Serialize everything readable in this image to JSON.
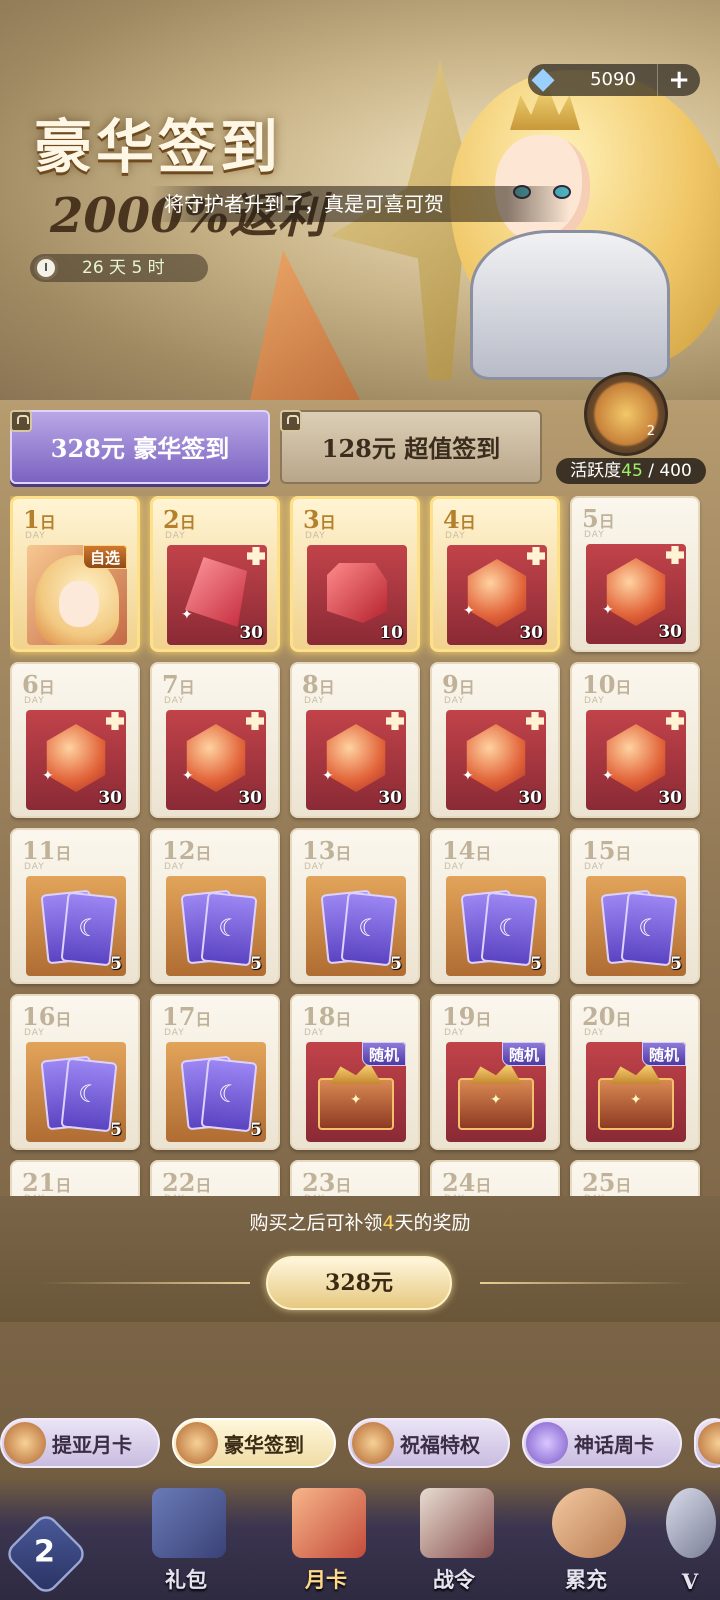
{
  "header": {
    "title": "豪华签到",
    "subtitle": "2000%返利",
    "ticker_pre": "将守护者",
    "ticker_mid": "升到了",
    "ticker_post": "，真是可喜可贺",
    "timer": "26 天 5 时"
  },
  "currency": {
    "icon": "diamond-icon",
    "amount": "5090",
    "add": "+"
  },
  "tabs": [
    {
      "label": "328元 豪华签到",
      "selected": true
    },
    {
      "label": "128元 超值签到",
      "selected": false
    }
  ],
  "activity": {
    "label": "活跃度",
    "current": "45",
    "total": "/ 400",
    "count": "2"
  },
  "day_suffix": "日",
  "day_sub": "DAY",
  "days": [
    {
      "day": "1",
      "item": "hero-portrait",
      "tag": "自选",
      "qty": ""
    },
    {
      "day": "2",
      "item": "red-crystal",
      "tag": "",
      "qty": "30"
    },
    {
      "day": "3",
      "item": "red-cube",
      "tag": "",
      "qty": "10"
    },
    {
      "day": "4",
      "item": "flame-gem",
      "tag": "",
      "qty": "30"
    },
    {
      "day": "5",
      "item": "flame-gem",
      "tag": "",
      "qty": "30"
    },
    {
      "day": "6",
      "item": "flame-gem",
      "tag": "",
      "qty": "30"
    },
    {
      "day": "7",
      "item": "flame-gem",
      "tag": "",
      "qty": "30"
    },
    {
      "day": "8",
      "item": "flame-gem",
      "tag": "",
      "qty": "30"
    },
    {
      "day": "9",
      "item": "flame-gem",
      "tag": "",
      "qty": "30"
    },
    {
      "day": "10",
      "item": "flame-gem",
      "tag": "",
      "qty": "30"
    },
    {
      "day": "11",
      "item": "moon-cards",
      "tag": "",
      "qty": "5"
    },
    {
      "day": "12",
      "item": "moon-cards",
      "tag": "",
      "qty": "5"
    },
    {
      "day": "13",
      "item": "moon-cards",
      "tag": "",
      "qty": "5"
    },
    {
      "day": "14",
      "item": "moon-cards",
      "tag": "",
      "qty": "5"
    },
    {
      "day": "15",
      "item": "moon-cards",
      "tag": "",
      "qty": "5"
    },
    {
      "day": "16",
      "item": "moon-cards",
      "tag": "",
      "qty": "5"
    },
    {
      "day": "17",
      "item": "moon-cards",
      "tag": "",
      "qty": "5"
    },
    {
      "day": "18",
      "item": "treasure-chest",
      "tag": "随机",
      "qty": ""
    },
    {
      "day": "19",
      "item": "treasure-chest",
      "tag": "随机",
      "qty": ""
    },
    {
      "day": "20",
      "item": "treasure-chest",
      "tag": "随机",
      "qty": ""
    },
    {
      "day": "21",
      "item": "",
      "tag": "",
      "qty": ""
    },
    {
      "day": "22",
      "item": "",
      "tag": "",
      "qty": ""
    },
    {
      "day": "23",
      "item": "",
      "tag": "",
      "qty": ""
    },
    {
      "day": "24",
      "item": "",
      "tag": "",
      "qty": ""
    },
    {
      "day": "25",
      "item": "",
      "tag": "",
      "qty": ""
    }
  ],
  "purchase": {
    "note_pre": "购买之后可补领",
    "note_days": "4",
    "note_post": "天的奖励",
    "price": "328元"
  },
  "subtabs": [
    "提亚月卡",
    "豪华签到",
    "祝福特权",
    "神话周卡"
  ],
  "nav": [
    "礼包",
    "月卡",
    "战令",
    "累充",
    "V"
  ],
  "colors": {
    "accent": "#7b63c2",
    "gold": "#f1d28e",
    "highlight": "#ffd561"
  }
}
